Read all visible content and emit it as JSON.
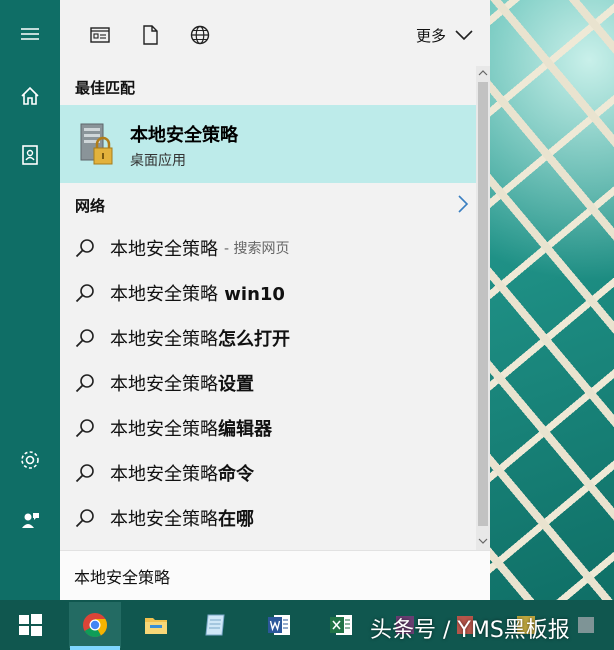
{
  "topbar": {
    "more_label": "更多"
  },
  "results": {
    "best_match_heading": "最佳匹配",
    "best_match": {
      "title": "本地安全策略",
      "subtitle": "桌面应用"
    },
    "network_heading": "网络",
    "suggestions": [
      {
        "base": "本地安全策略",
        "suffix": "",
        "hint": "- 搜索网页"
      },
      {
        "base": "本地安全策略",
        "suffix": " win10",
        "hint": ""
      },
      {
        "base": "本地安全策略",
        "suffix": "怎么打开",
        "hint": ""
      },
      {
        "base": "本地安全策略",
        "suffix": "设置",
        "hint": ""
      },
      {
        "base": "本地安全策略",
        "suffix": "编辑器",
        "hint": ""
      },
      {
        "base": "本地安全策略",
        "suffix": "命令",
        "hint": ""
      },
      {
        "base": "本地安全策略",
        "suffix": "在哪",
        "hint": ""
      }
    ]
  },
  "search": {
    "value": "本地安全策略"
  },
  "watermark": "头条号 / YMS黑板报",
  "colors": {
    "accent": "#0f6e66",
    "highlight": "#bdebea",
    "taskbar": "#10574f"
  },
  "icons": {
    "rail": [
      "hamburger-icon",
      "home-icon",
      "notebook-icon",
      "settings-icon",
      "feedback-icon"
    ],
    "filters": [
      "apps-filter-icon",
      "documents-filter-icon",
      "web-filter-icon"
    ],
    "taskbar": [
      "windows-start-icon",
      "chrome-icon",
      "file-explorer-icon",
      "notepad-icon",
      "word-icon",
      "excel-icon"
    ]
  }
}
